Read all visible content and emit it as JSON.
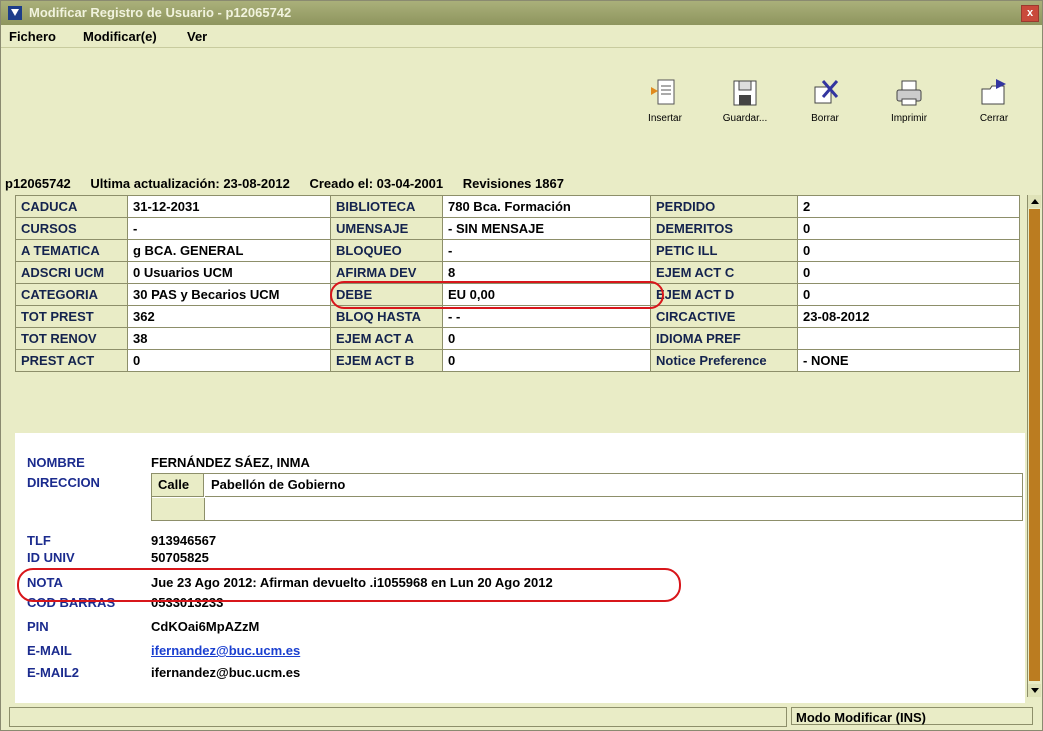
{
  "window": {
    "title": "Modificar Registro de Usuario - p12065742",
    "close_label": "x"
  },
  "menu": {
    "fichero": "Fichero",
    "modificar": "Modificar(e)",
    "ver": "Ver"
  },
  "toolbar": {
    "insertar": "Insertar",
    "guardar": "Guardar...",
    "borrar": "Borrar",
    "imprimir": "Imprimir",
    "cerrar": "Cerrar"
  },
  "info": {
    "record_id": "p12065742",
    "updated": "Ultima actualización: 23-08-2012",
    "created": "Creado el: 03-04-2001",
    "revisions": "Revisiones 1867"
  },
  "grid": {
    "rows": [
      [
        "CADUCA",
        "31-12-2031",
        "BIBLIOTECA",
        "780   Bca. Formación",
        "PERDIDO",
        "2"
      ],
      [
        "CURSOS",
        "-",
        "UMENSAJE",
        "-   SIN MENSAJE",
        "DEMERITOS",
        "0"
      ],
      [
        "A TEMATICA",
        "g   BCA. GENERAL",
        "BLOQUEO",
        "-",
        "PETIC ILL",
        "0"
      ],
      [
        "ADSCRI UCM",
        "0   Usuarios UCM",
        "AFIRMA DEV",
        "8",
        "EJEM ACT C",
        "0"
      ],
      [
        "CATEGORIA",
        "30   PAS y Becarios UCM",
        "DEBE",
        "EU 0,00",
        "EJEM ACT D",
        "0"
      ],
      [
        "TOT PREST",
        "362",
        "BLOQ HASTA",
        "- -",
        "CIRCACTIVE",
        "23-08-2012"
      ],
      [
        "TOT RENOV",
        "38",
        "EJEM ACT A",
        "0",
        "IDIOMA PREF",
        ""
      ],
      [
        "PREST ACT",
        "0",
        "EJEM ACT B",
        "0",
        "Notice Preference",
        "-   NONE"
      ]
    ]
  },
  "details": {
    "nombre_label": "NOMBRE",
    "nombre": "FERNÁNDEZ SÁEZ, INMA",
    "direccion_label": "DIRECCION",
    "calle_label": "Calle",
    "calle": "Pabellón de Gobierno",
    "tlf_label": "TLF",
    "tlf": "913946567",
    "id_label": "ID UNIV",
    "id": "50705825",
    "nota_label": "NOTA",
    "nota": "Jue 23 Ago 2012: Afirman devuelto .i1055968 en Lun 20 Ago 2012",
    "barras_label": "COD BARRAS",
    "barras": "0533013233",
    "pin_label": "PIN",
    "pin": "CdKOai6MpAZzM",
    "email_label": "E-MAIL",
    "email": "ifernandez@buc.ucm.es",
    "email2_label": "E-MAIL2",
    "email2": "ifernandez@buc.ucm.es"
  },
  "status": {
    "mode": "Modo Modificar (INS)"
  },
  "colors": {
    "background": "#e9ecc6",
    "label_blue": "#1b2b8e",
    "highlight_red": "#d8161b",
    "scroll_thumb": "#bb7c20"
  }
}
